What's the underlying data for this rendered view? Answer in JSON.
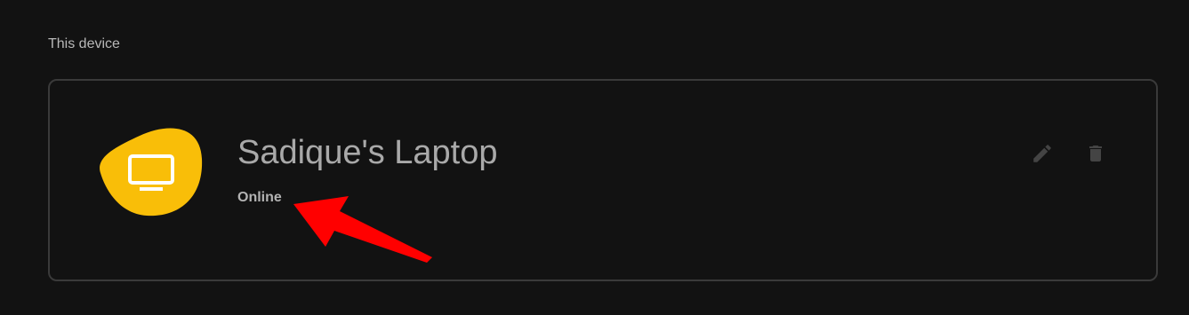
{
  "section": {
    "title": "This device"
  },
  "device": {
    "name": "Sadique's Laptop",
    "status": "Online",
    "icon": "monitor-icon",
    "accent_color": "#F9BE08"
  },
  "actions": {
    "edit_icon": "pencil-icon",
    "delete_icon": "trash-icon"
  },
  "annotation": {
    "color": "#FF0000"
  }
}
